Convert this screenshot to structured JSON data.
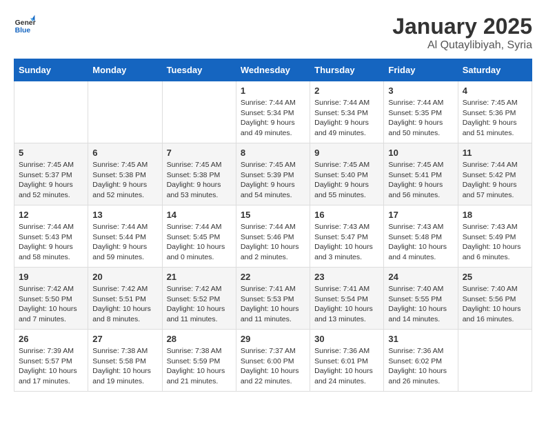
{
  "logo": {
    "line1": "General",
    "line2": "Blue"
  },
  "title": "January 2025",
  "subtitle": "Al Qutaylibiyah, Syria",
  "days_of_week": [
    "Sunday",
    "Monday",
    "Tuesday",
    "Wednesday",
    "Thursday",
    "Friday",
    "Saturday"
  ],
  "weeks": [
    [
      {
        "day": "",
        "info": ""
      },
      {
        "day": "",
        "info": ""
      },
      {
        "day": "",
        "info": ""
      },
      {
        "day": "1",
        "info": "Sunrise: 7:44 AM\nSunset: 5:34 PM\nDaylight: 9 hours and 49 minutes."
      },
      {
        "day": "2",
        "info": "Sunrise: 7:44 AM\nSunset: 5:34 PM\nDaylight: 9 hours and 49 minutes."
      },
      {
        "day": "3",
        "info": "Sunrise: 7:44 AM\nSunset: 5:35 PM\nDaylight: 9 hours and 50 minutes."
      },
      {
        "day": "4",
        "info": "Sunrise: 7:45 AM\nSunset: 5:36 PM\nDaylight: 9 hours and 51 minutes."
      }
    ],
    [
      {
        "day": "5",
        "info": "Sunrise: 7:45 AM\nSunset: 5:37 PM\nDaylight: 9 hours and 52 minutes."
      },
      {
        "day": "6",
        "info": "Sunrise: 7:45 AM\nSunset: 5:38 PM\nDaylight: 9 hours and 52 minutes."
      },
      {
        "day": "7",
        "info": "Sunrise: 7:45 AM\nSunset: 5:38 PM\nDaylight: 9 hours and 53 minutes."
      },
      {
        "day": "8",
        "info": "Sunrise: 7:45 AM\nSunset: 5:39 PM\nDaylight: 9 hours and 54 minutes."
      },
      {
        "day": "9",
        "info": "Sunrise: 7:45 AM\nSunset: 5:40 PM\nDaylight: 9 hours and 55 minutes."
      },
      {
        "day": "10",
        "info": "Sunrise: 7:45 AM\nSunset: 5:41 PM\nDaylight: 9 hours and 56 minutes."
      },
      {
        "day": "11",
        "info": "Sunrise: 7:44 AM\nSunset: 5:42 PM\nDaylight: 9 hours and 57 minutes."
      }
    ],
    [
      {
        "day": "12",
        "info": "Sunrise: 7:44 AM\nSunset: 5:43 PM\nDaylight: 9 hours and 58 minutes."
      },
      {
        "day": "13",
        "info": "Sunrise: 7:44 AM\nSunset: 5:44 PM\nDaylight: 9 hours and 59 minutes."
      },
      {
        "day": "14",
        "info": "Sunrise: 7:44 AM\nSunset: 5:45 PM\nDaylight: 10 hours and 0 minutes."
      },
      {
        "day": "15",
        "info": "Sunrise: 7:44 AM\nSunset: 5:46 PM\nDaylight: 10 hours and 2 minutes."
      },
      {
        "day": "16",
        "info": "Sunrise: 7:43 AM\nSunset: 5:47 PM\nDaylight: 10 hours and 3 minutes."
      },
      {
        "day": "17",
        "info": "Sunrise: 7:43 AM\nSunset: 5:48 PM\nDaylight: 10 hours and 4 minutes."
      },
      {
        "day": "18",
        "info": "Sunrise: 7:43 AM\nSunset: 5:49 PM\nDaylight: 10 hours and 6 minutes."
      }
    ],
    [
      {
        "day": "19",
        "info": "Sunrise: 7:42 AM\nSunset: 5:50 PM\nDaylight: 10 hours and 7 minutes."
      },
      {
        "day": "20",
        "info": "Sunrise: 7:42 AM\nSunset: 5:51 PM\nDaylight: 10 hours and 8 minutes."
      },
      {
        "day": "21",
        "info": "Sunrise: 7:42 AM\nSunset: 5:52 PM\nDaylight: 10 hours and 11 minutes."
      },
      {
        "day": "22",
        "info": "Sunrise: 7:41 AM\nSunset: 5:53 PM\nDaylight: 10 hours and 11 minutes."
      },
      {
        "day": "23",
        "info": "Sunrise: 7:41 AM\nSunset: 5:54 PM\nDaylight: 10 hours and 13 minutes."
      },
      {
        "day": "24",
        "info": "Sunrise: 7:40 AM\nSunset: 5:55 PM\nDaylight: 10 hours and 14 minutes."
      },
      {
        "day": "25",
        "info": "Sunrise: 7:40 AM\nSunset: 5:56 PM\nDaylight: 10 hours and 16 minutes."
      }
    ],
    [
      {
        "day": "26",
        "info": "Sunrise: 7:39 AM\nSunset: 5:57 PM\nDaylight: 10 hours and 17 minutes."
      },
      {
        "day": "27",
        "info": "Sunrise: 7:38 AM\nSunset: 5:58 PM\nDaylight: 10 hours and 19 minutes."
      },
      {
        "day": "28",
        "info": "Sunrise: 7:38 AM\nSunset: 5:59 PM\nDaylight: 10 hours and 21 minutes."
      },
      {
        "day": "29",
        "info": "Sunrise: 7:37 AM\nSunset: 6:00 PM\nDaylight: 10 hours and 22 minutes."
      },
      {
        "day": "30",
        "info": "Sunrise: 7:36 AM\nSunset: 6:01 PM\nDaylight: 10 hours and 24 minutes."
      },
      {
        "day": "31",
        "info": "Sunrise: 7:36 AM\nSunset: 6:02 PM\nDaylight: 10 hours and 26 minutes."
      },
      {
        "day": "",
        "info": ""
      }
    ]
  ]
}
